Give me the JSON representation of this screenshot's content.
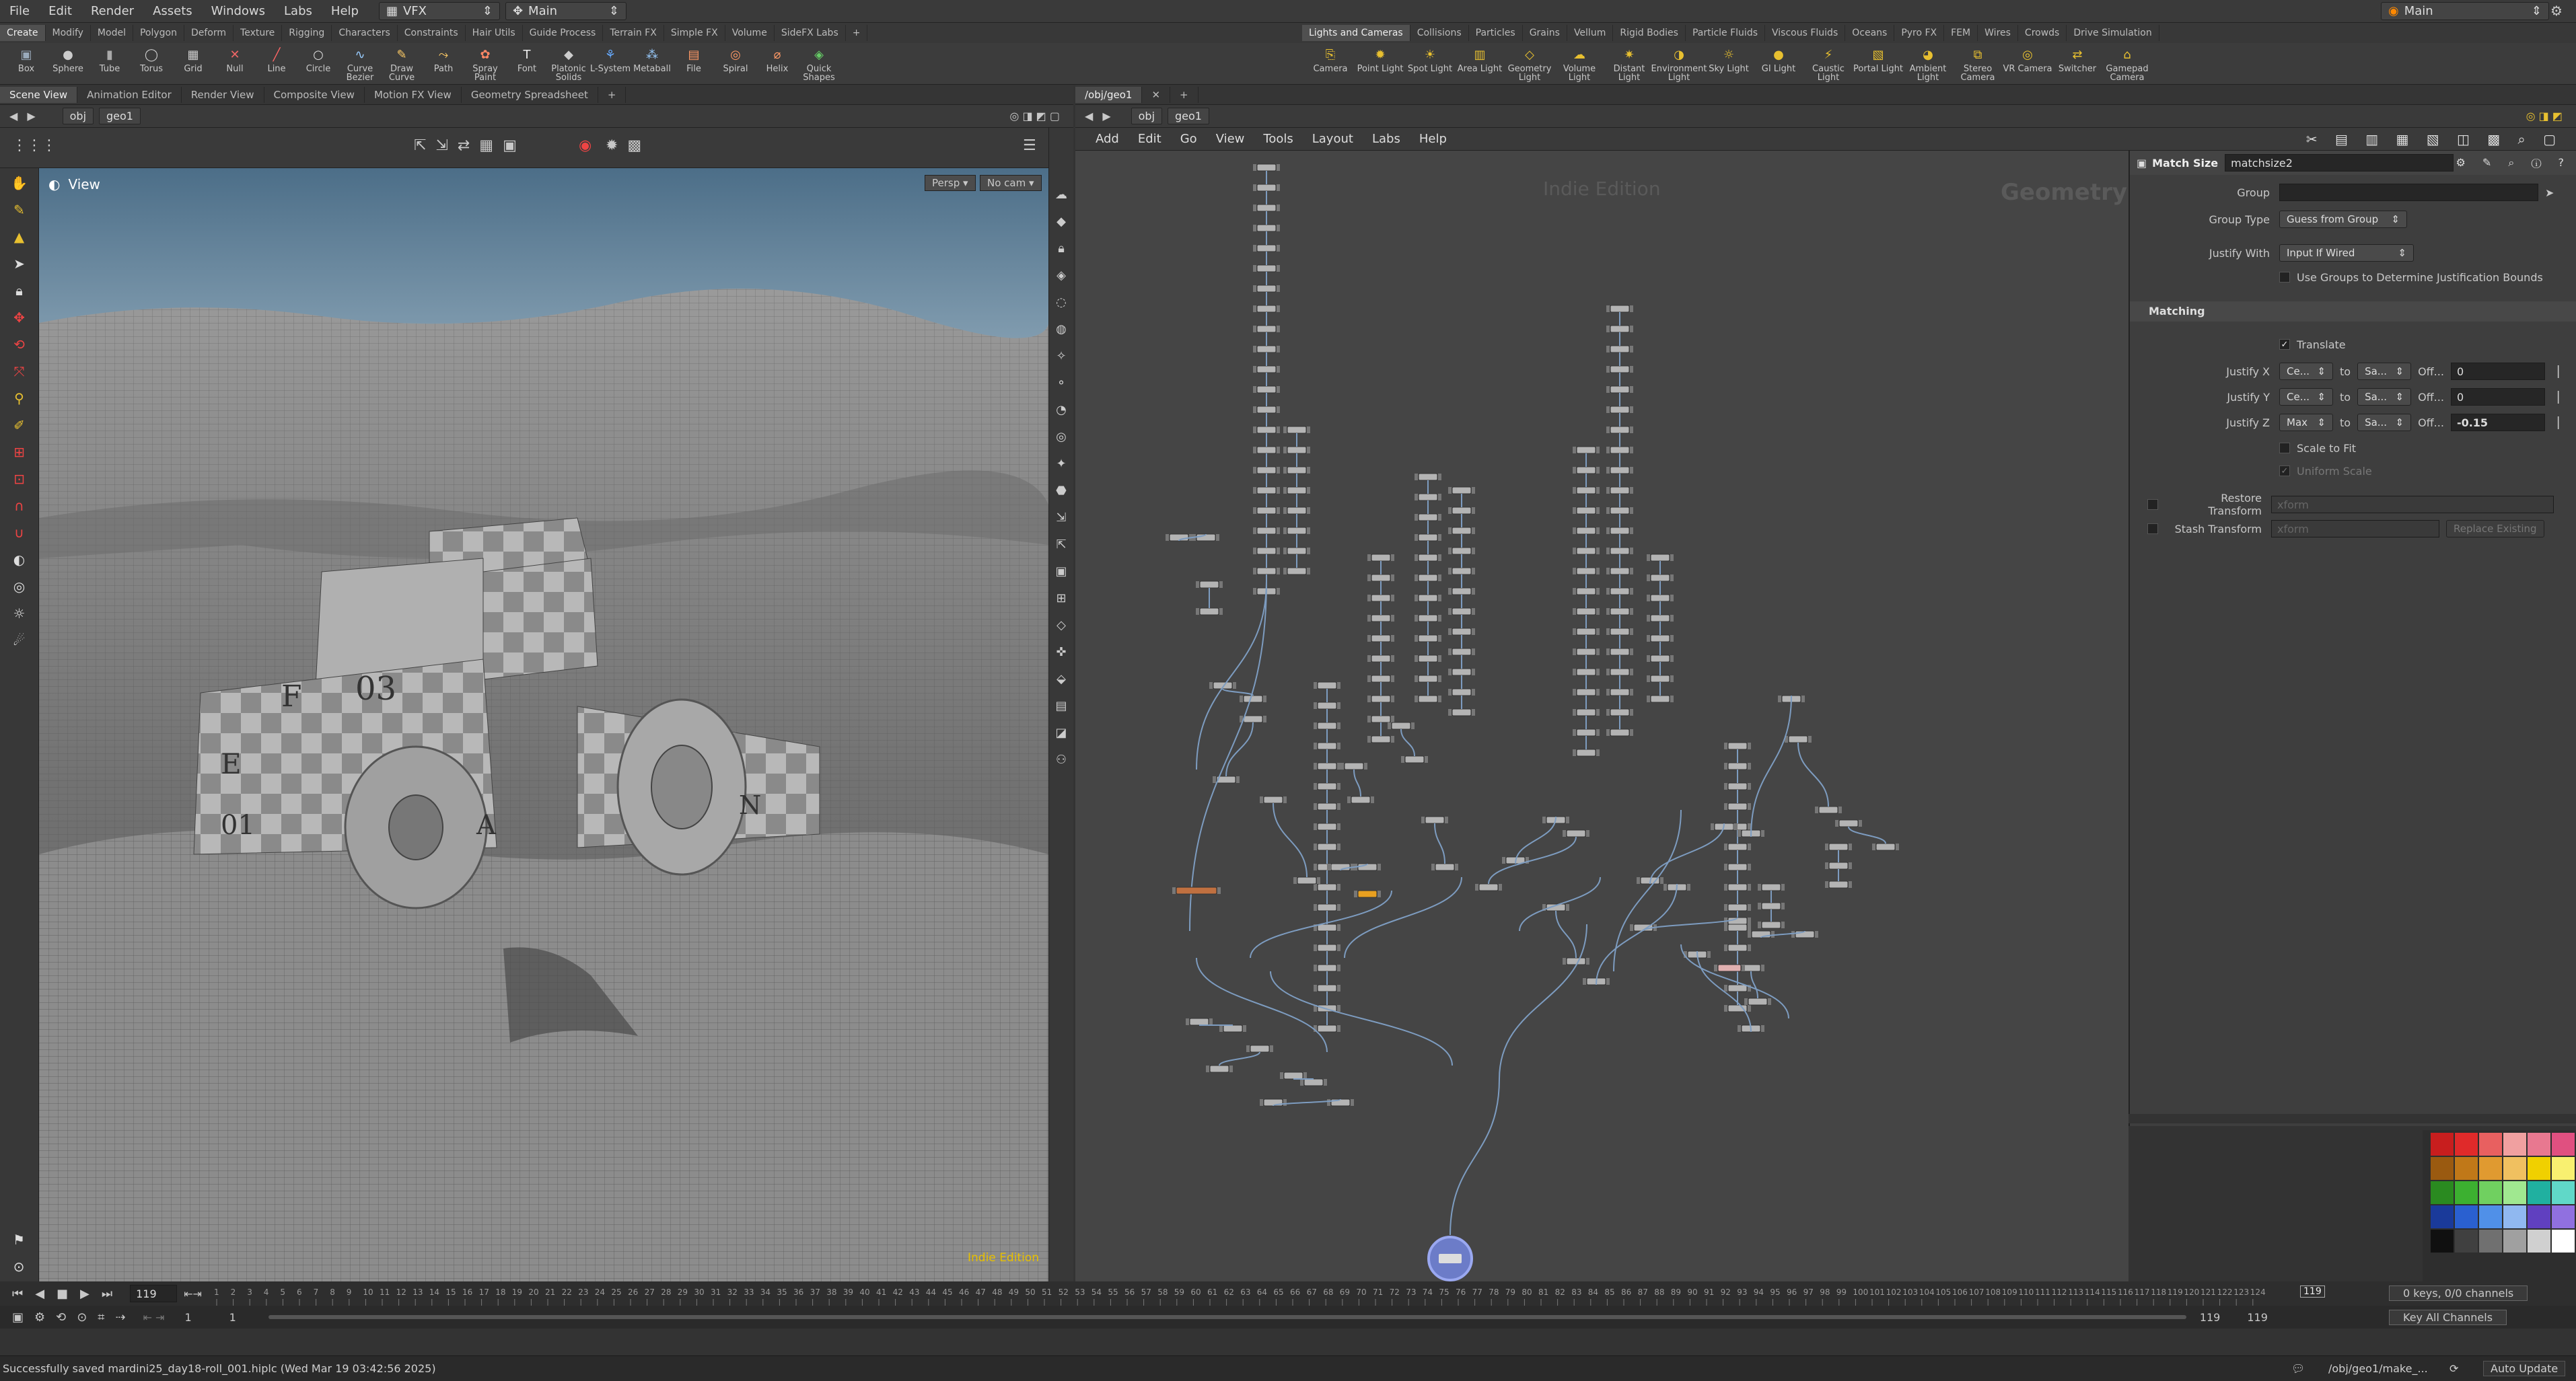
{
  "menu": {
    "items": [
      "File",
      "Edit",
      "Render",
      "Assets",
      "Windows",
      "Labs",
      "Help"
    ],
    "desktop": "VFX",
    "context": "Main",
    "right_desktop": "Main"
  },
  "shelf_tabs_left": [
    "Create",
    "Modify",
    "Model",
    "Polygon",
    "Deform",
    "Texture",
    "Rigging",
    "Characters",
    "Constraints",
    "Hair Utils",
    "Guide Process",
    "Terrain FX",
    "Simple FX",
    "Volume",
    "SideFX Labs"
  ],
  "shelf_tools_left": [
    {
      "label": "Box",
      "icon": "box-icon"
    },
    {
      "label": "Sphere",
      "icon": "sphere-icon"
    },
    {
      "label": "Tube",
      "icon": "tube-icon"
    },
    {
      "label": "Torus",
      "icon": "torus-icon"
    },
    {
      "label": "Grid",
      "icon": "grid-icon"
    },
    {
      "label": "Null",
      "icon": "null-icon"
    },
    {
      "label": "Line",
      "icon": "line-icon"
    },
    {
      "label": "Circle",
      "icon": "circle-icon"
    },
    {
      "label": "Curve Bezier",
      "icon": "curve-icon"
    },
    {
      "label": "Draw Curve",
      "icon": "pen-icon"
    },
    {
      "label": "Path",
      "icon": "path-icon"
    },
    {
      "label": "Spray Paint",
      "icon": "spray-icon"
    },
    {
      "label": "Font",
      "icon": "font-icon"
    },
    {
      "label": "Platonic Solids",
      "icon": "platonic-icon"
    },
    {
      "label": "L-System",
      "icon": "lsystem-icon"
    },
    {
      "label": "Metaball",
      "icon": "metaball-icon"
    },
    {
      "label": "File",
      "icon": "file-icon"
    },
    {
      "label": "Spiral",
      "icon": "spiral-icon"
    },
    {
      "label": "Helix",
      "icon": "helix-icon"
    },
    {
      "label": "Quick Shapes",
      "icon": "quickshapes-icon"
    }
  ],
  "shelf_tabs_right": [
    "Lights and Cameras",
    "Collisions",
    "Particles",
    "Grains",
    "Vellum",
    "Rigid Bodies",
    "Particle Fluids",
    "Viscous Fluids",
    "Oceans",
    "Pyro FX",
    "FEM",
    "Wires",
    "Crowds",
    "Drive Simulation"
  ],
  "shelf_tools_right": [
    {
      "label": "Camera",
      "icon": "camera-icon"
    },
    {
      "label": "Point Light",
      "icon": "point-light-icon"
    },
    {
      "label": "Spot Light",
      "icon": "spot-light-icon"
    },
    {
      "label": "Area Light",
      "icon": "area-light-icon"
    },
    {
      "label": "Geometry Light",
      "icon": "geometry-light-icon"
    },
    {
      "label": "Volume Light",
      "icon": "volume-light-icon"
    },
    {
      "label": "Distant Light",
      "icon": "distant-light-icon"
    },
    {
      "label": "Environment Light",
      "icon": "environment-light-icon"
    },
    {
      "label": "Sky Light",
      "icon": "sky-light-icon"
    },
    {
      "label": "GI Light",
      "icon": "gi-light-icon"
    },
    {
      "label": "Caustic Light",
      "icon": "caustic-light-icon"
    },
    {
      "label": "Portal Light",
      "icon": "portal-light-icon"
    },
    {
      "label": "Ambient Light",
      "icon": "ambient-light-icon"
    },
    {
      "label": "Stereo Camera",
      "icon": "stereo-camera-icon"
    },
    {
      "label": "VR Camera",
      "icon": "vr-camera-icon"
    },
    {
      "label": "Switcher",
      "icon": "switcher-icon"
    },
    {
      "label": "Gamepad Camera",
      "icon": "gamepad-camera-icon"
    }
  ],
  "left_pane_tabs": [
    "Scene View",
    "Animation Editor",
    "Render View",
    "Composite View",
    "Motion FX View",
    "Geometry Spreadsheet"
  ],
  "left_path": [
    "obj",
    "geo1"
  ],
  "viewport": {
    "title": "View",
    "persp": "Persp",
    "cam": "No cam",
    "edition": "Indie Edition"
  },
  "right_path_tab": "/obj/geo1",
  "right_path": [
    "obj",
    "geo1"
  ],
  "network_menu": [
    "Add",
    "Edit",
    "Go",
    "View",
    "Tools",
    "Layout",
    "Labs",
    "Help"
  ],
  "network_watermark": {
    "edition": "Indie Edition",
    "context": "Geometry"
  },
  "params": {
    "node_type": "Match Size",
    "node_name": "matchsize2",
    "group_label": "Group",
    "group_value": "",
    "group_type_label": "Group Type",
    "group_type_value": "Guess from Group",
    "justify_with_label": "Justify With",
    "justify_with_value": "Input If Wired",
    "use_groups_label": "Use Groups to Determine Justification Bounds",
    "section_matching": "Matching",
    "translate_label": "Translate",
    "justify_rows": [
      {
        "label": "Justify X",
        "from": "Ce...",
        "to_word": "to",
        "to": "Sa...",
        "off": "Off...",
        "value": "0"
      },
      {
        "label": "Justify Y",
        "from": "Ce...",
        "to_word": "to",
        "to": "Sa...",
        "off": "Off...",
        "value": "0"
      },
      {
        "label": "Justify Z",
        "from": "Max",
        "to_word": "to",
        "to": "Sa...",
        "off": "Off...",
        "value": "-0.15"
      }
    ],
    "scale_to_fit_label": "Scale to Fit",
    "uniform_scale_label": "Uniform Scale",
    "restore_transform_label": "Restore Transform",
    "restore_placeholder": "xform",
    "stash_transform_label": "Stash Transform",
    "stash_placeholder": "xform",
    "replace_existing": "Replace Existing"
  },
  "palette_colors": [
    "#c81e1e",
    "#e02a2a",
    "#e86060",
    "#f0a0a0",
    "#e87890",
    "#e05080",
    "#9a5a10",
    "#c07818",
    "#e09a30",
    "#f0c060",
    "#f0d000",
    "#f8f070",
    "#2a8a20",
    "#3cb030",
    "#70d060",
    "#a0e890",
    "#20b0a0",
    "#60d8c8",
    "#1a3a9a",
    "#2a60d0",
    "#5090e8",
    "#90b8f0",
    "#6040c0",
    "#9070e0",
    "#101010",
    "#404040",
    "#707070",
    "#a0a0a0",
    "#d0d0d0",
    "#ffffff"
  ],
  "timeline": {
    "current_frame": "119",
    "start": "1",
    "start2": "1",
    "end": "119",
    "end2": "119",
    "frame_marker": "119",
    "keys": "0 keys, 0/0 channels",
    "key_all": "Key All Channels",
    "auto_update": "Auto Update",
    "path": "/obj/geo1/make_..."
  },
  "status": {
    "message": "Successfully saved mardini25_day18-roll_001.hiplc (Wed Mar 19 03:42:56 2025)"
  }
}
